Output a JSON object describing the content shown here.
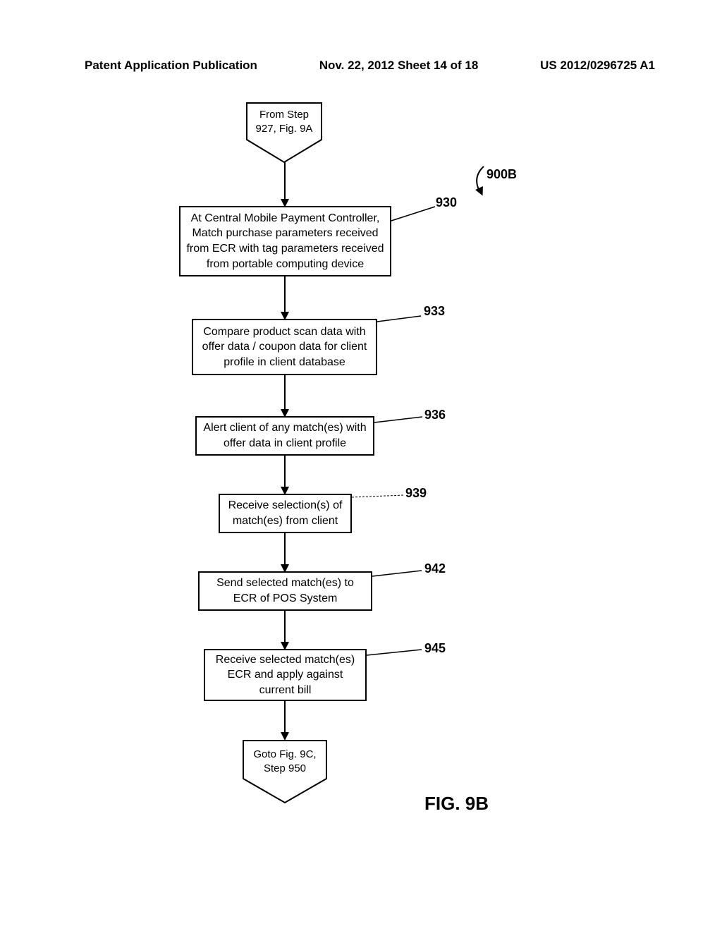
{
  "header": {
    "left": "Patent Application Publication",
    "center": "Nov. 22, 2012  Sheet 14 of 18",
    "right": "US 2012/0296725 A1"
  },
  "flowchart": {
    "entry": "From Step\n927, Fig. 9A",
    "step930": {
      "text": "At Central Mobile Payment Controller, Match purchase parameters received from ECR with tag parameters received from portable computing device",
      "ref": "930"
    },
    "step933": {
      "text": "Compare product scan data with offer data / coupon data for client profile in client database",
      "ref": "933"
    },
    "step936": {
      "text": "Alert client of any match(es) with offer data in client profile",
      "ref": "936"
    },
    "step939": {
      "text": "Receive selection(s) of match(es) from client",
      "ref": "939"
    },
    "step942": {
      "text": "Send selected match(es) to ECR of POS System",
      "ref": "942"
    },
    "step945": {
      "text": "Receive selected match(es) ECR and apply against current bill",
      "ref": "945"
    },
    "exit": "Goto Fig. 9C,\nStep 950",
    "flowref": "900B",
    "figure": "FIG. 9B"
  }
}
